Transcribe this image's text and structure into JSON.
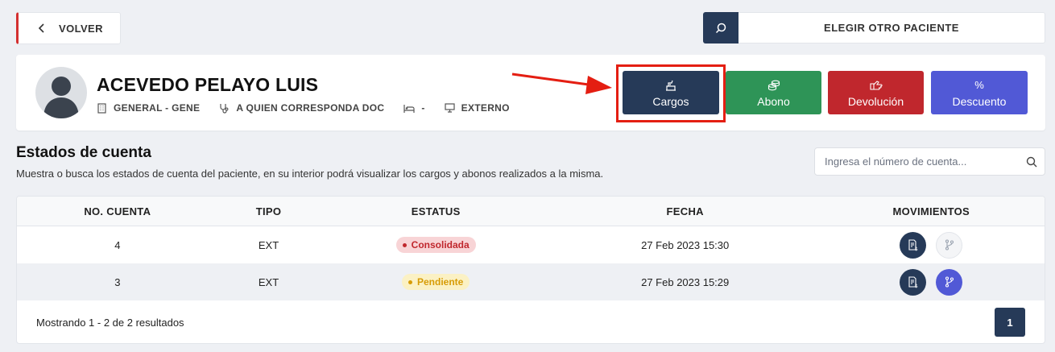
{
  "header": {
    "back_label": "VOLVER",
    "choose_patient_label": "ELEGIR OTRO PACIENTE"
  },
  "patient": {
    "name": "ACEVEDO PELAYO LUIS",
    "area": "GENERAL - GENE",
    "doctor": "A QUIEN CORRESPONDA DOC",
    "bed": "-",
    "type": "EXTERNO"
  },
  "actions": {
    "cargos": "Cargos",
    "abono": "Abono",
    "devolucion": "Devolución",
    "descuento": "Descuento",
    "descuento_icon_text": "%"
  },
  "accounts": {
    "title": "Estados de cuenta",
    "description": "Muestra o busca los estados de cuenta del paciente, en su interior podrá visualizar los cargos y abonos realizados a la misma.",
    "search_placeholder": "Ingresa el número de cuenta...",
    "columns": [
      "NO. CUENTA",
      "TIPO",
      "ESTATUS",
      "FECHA",
      "MOVIMIENTOS"
    ],
    "rows": [
      {
        "number": "4",
        "type": "EXT",
        "status": "Consolidada",
        "date": "27 Feb 2023 15:30"
      },
      {
        "number": "3",
        "type": "EXT",
        "status": "Pendiente",
        "date": "27 Feb 2023 15:29"
      }
    ],
    "footer_text": "Mostrando 1 - 2 de 2 resultados",
    "current_page": "1"
  },
  "colors": {
    "navy": "#263a58",
    "green": "#2e9457",
    "red": "#c0272d",
    "indigo": "#5159d6",
    "highlight": "#e41e12"
  }
}
